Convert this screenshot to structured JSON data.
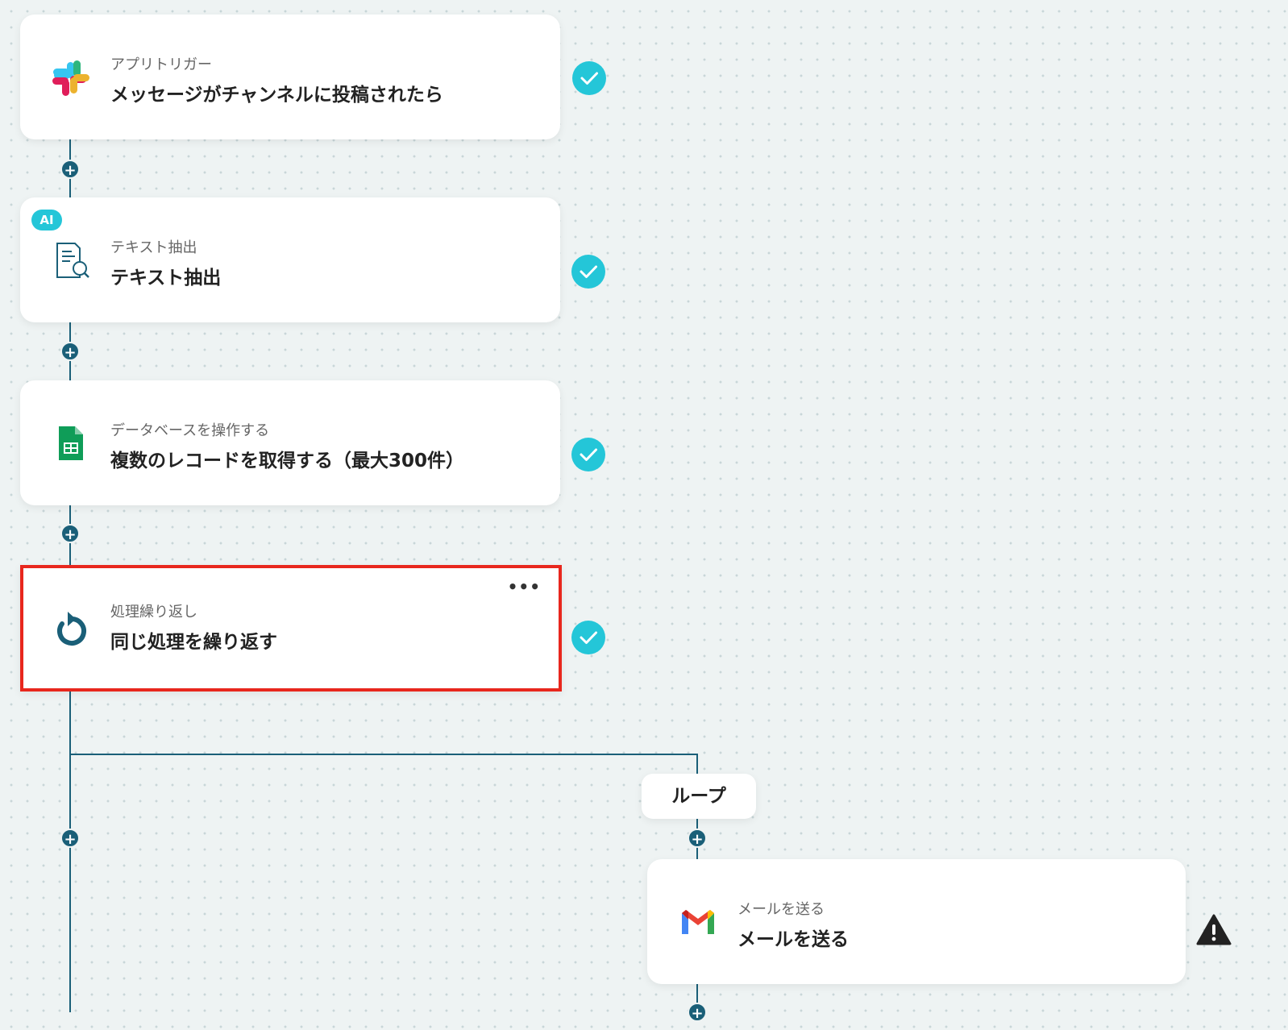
{
  "flow": {
    "steps": [
      {
        "subtitle": "アプリトリガー",
        "title": "メッセージがチャンネルに投稿されたら",
        "icon": "slack-icon",
        "status": "completed"
      },
      {
        "subtitle": "テキスト抽出",
        "title": "テキスト抽出",
        "icon": "document-search-icon",
        "badge": "AI",
        "status": "completed"
      },
      {
        "subtitle": "データベースを操作する",
        "title": "複数のレコードを取得する（最大300件）",
        "icon": "google-sheets-icon",
        "status": "completed"
      },
      {
        "subtitle": "処理繰り返し",
        "title": "同じ処理を繰り返す",
        "icon": "repeat-icon",
        "status": "completed",
        "selected": true,
        "menu": "•••"
      }
    ],
    "loop": {
      "label": "ループ",
      "steps": [
        {
          "subtitle": "メールを送る",
          "title": "メールを送る",
          "icon": "gmail-icon",
          "status": "warning"
        }
      ]
    }
  },
  "colors": {
    "connector": "#1a5f78",
    "check": "#24c6d8",
    "selected_border": "#e8271d",
    "warning": "#222222"
  }
}
